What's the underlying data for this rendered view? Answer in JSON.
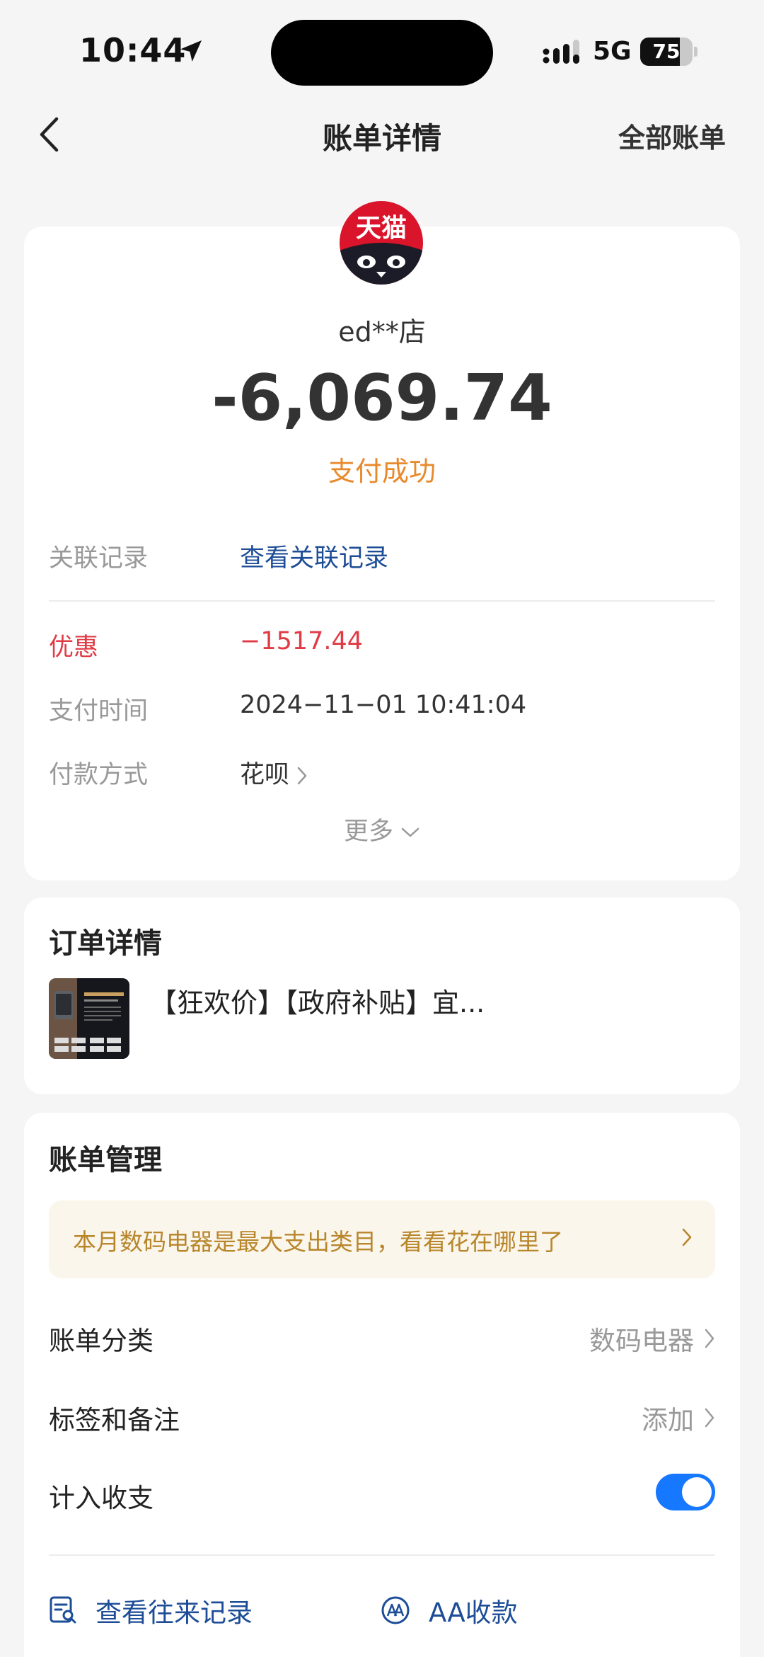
{
  "status_bar": {
    "time": "10:44",
    "network": "5G",
    "battery_level": 75,
    "battery_text": "75"
  },
  "nav": {
    "title": "账单详情",
    "right_link": "全部账单"
  },
  "merchant": {
    "logo_text": "天猫",
    "name": "ed**店",
    "amount": "-6,069.74",
    "status": "支付成功"
  },
  "details": {
    "related": {
      "label": "关联记录",
      "value": "查看关联记录"
    },
    "discount": {
      "label": "优惠",
      "value": "−1517.44"
    },
    "pay_time": {
      "label": "支付时间",
      "value": "2024−11−01 10:41:04"
    },
    "pay_method": {
      "label": "付款方式",
      "value": "花呗"
    },
    "more": "更多"
  },
  "order": {
    "title": "订单详情",
    "product_name": "【狂欢价】【政府补贴】宜..."
  },
  "management": {
    "title": "账单管理",
    "tip": "本月数码电器是最大支出类目，看看花在哪里了",
    "category": {
      "label": "账单分类",
      "value": "数码电器"
    },
    "tags": {
      "label": "标签和备注",
      "value": "添加"
    },
    "include": {
      "label": "计入收支",
      "enabled": true
    },
    "actions": {
      "records": "查看往来记录",
      "aa": "AA收款"
    }
  },
  "colors": {
    "accent_blue": "#1677ff",
    "link_blue": "#1d4d97",
    "success_orange": "#e8892c",
    "discount_red": "#e03b45",
    "tip_gold": "#b8862b"
  }
}
